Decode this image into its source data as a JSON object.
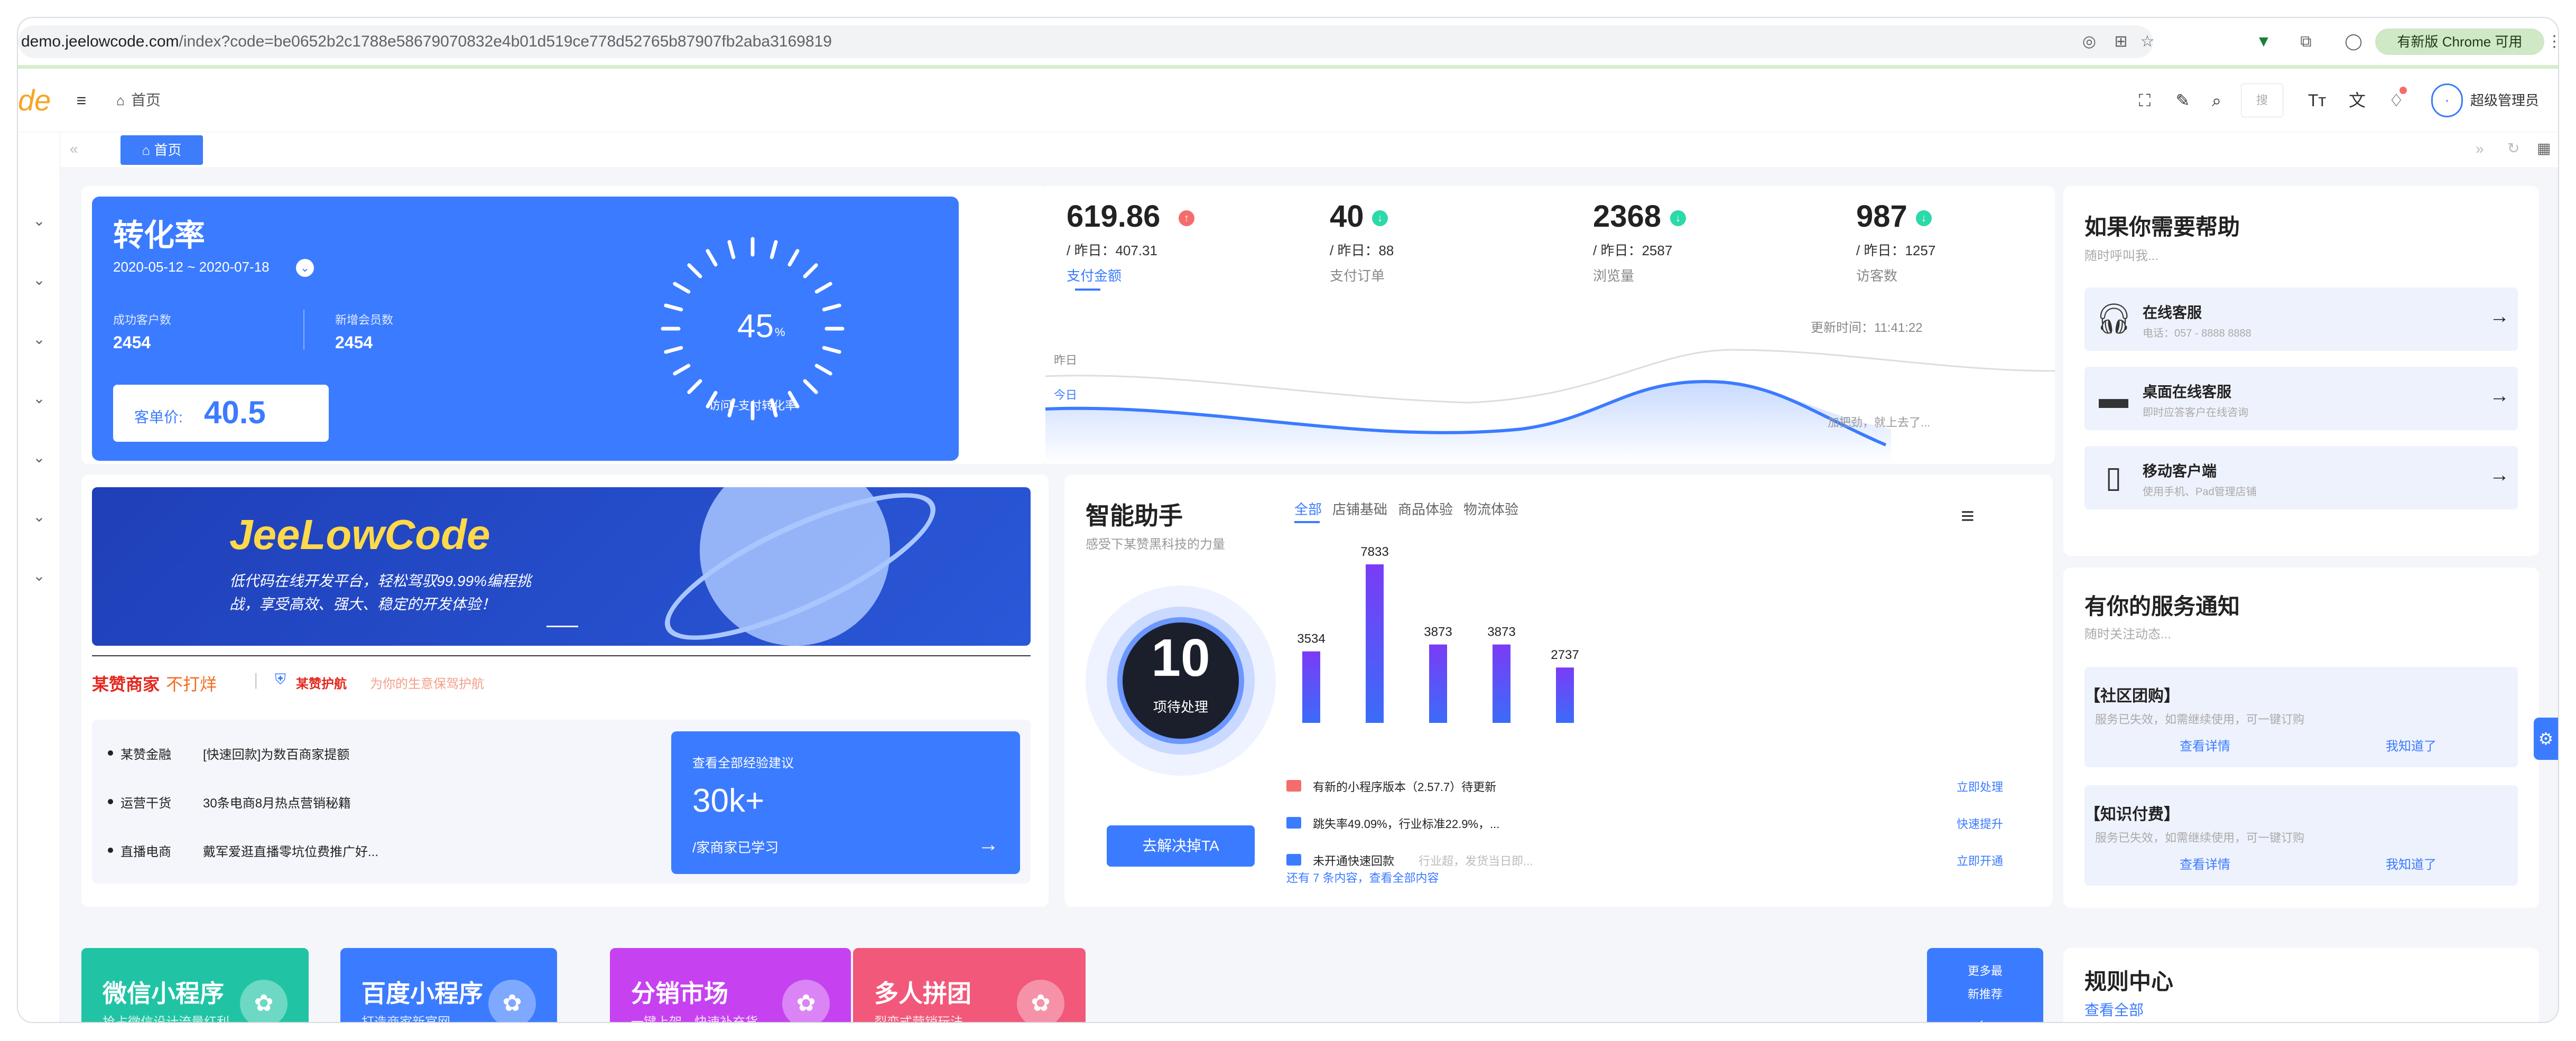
{
  "browser": {
    "url_host": "demo.jeelowcode.com",
    "url_path": "/index?code=be0652b2c1788e58679070832e4b01d519ce778d52765b87907fb2aba3169819",
    "update_button": "有新版 Chrome 可用"
  },
  "header": {
    "breadcrumb": "首页",
    "user": "超级管理员",
    "search_placeholder": "搜"
  },
  "tabs": [
    {
      "label": "首页"
    }
  ],
  "conversion": {
    "title": "转化率",
    "date_range": "2020-05-12 ~ 2020-07-18",
    "stat1_label": "成功客户数",
    "stat1_value": "2454",
    "stat2_label": "新增会员数",
    "stat2_value": "2454",
    "price_label": "客单价:",
    "price_value": "40.5",
    "gauge_value": "45",
    "gauge_unit": "%",
    "gauge_label": "访问–支付转化率"
  },
  "metrics": [
    {
      "value": "619.86",
      "yesterday": "/ 昨日：407.31",
      "label": "支付金额",
      "trend": "up",
      "color": "#f56c6c"
    },
    {
      "value": "40",
      "yesterday": "/ 昨日：88",
      "label": "支付订单",
      "trend": "down",
      "color": "#2bd9a9"
    },
    {
      "value": "2368",
      "yesterday": "/ 昨日：2587",
      "label": "浏览量",
      "trend": "down",
      "color": "#2bd9a9"
    },
    {
      "value": "987",
      "yesterday": "/ 昨日：1257",
      "label": "访客数",
      "trend": "down",
      "color": "#2bd9a9"
    }
  ],
  "trend_chart": {
    "update_time": "更新时间：11:41:22",
    "label_yesterday": "昨日",
    "label_today": "今日",
    "hint": "加把劲，就上去了..."
  },
  "help": {
    "title": "如果你需要帮助",
    "subtitle": "随时呼叫我...",
    "items": [
      {
        "title": "在线客服",
        "desc": "电话：057 - 8888 8888",
        "icon": "headset-icon"
      },
      {
        "title": "桌面在线客服",
        "desc": "即时应答客户在线咨询",
        "icon": "monitor-icon"
      },
      {
        "title": "移动客户端",
        "desc": "使用手机、Pad管理店铺",
        "icon": "mobile-icon"
      }
    ]
  },
  "banner": {
    "brand": "JeeLowCode",
    "line1": "低代码在线开发平台，轻松驾驭99.99%编程挑",
    "line2": "战，享受高效、强大、稳定的开发体验！"
  },
  "merchant": {
    "title_a": "某赞商家",
    "title_b": "不打烊",
    "guard": "某赞护航",
    "guard_desc": "为你的生意保驾护航",
    "list": [
      {
        "tag": "某赞金融",
        "text": "[快速回款]为数百商家提额"
      },
      {
        "tag": "运营干货",
        "text": "30条电商8月热点营销秘籍"
      },
      {
        "tag": "直播电商",
        "text": "戴军爱逛直播零坑位费推广好..."
      }
    ],
    "cta_label": "查看全部经验建议",
    "cta_value": "30k+",
    "cta_desc": "/家商家已学习"
  },
  "assistant": {
    "title": "智能助手",
    "subtitle": "感受下某赞黑科技的力量",
    "tabs": [
      "全部",
      "店铺基础",
      "商品体验",
      "物流体验"
    ],
    "pending_value": "10",
    "pending_label": "项待处理",
    "solve_button": "去解决掉TA",
    "items": [
      {
        "text": "有新的小程序版本（2.57.7）待更新",
        "extra": "",
        "action": "立即处理",
        "color": "#f56c6c"
      },
      {
        "text": "跳失率49.09%，行业标准22.9%，...",
        "extra": "",
        "action": "快速提升",
        "color": "#3b7bff"
      },
      {
        "text": "未开通快速回款",
        "extra": "行业超，发货当日即...",
        "action": "立即开通",
        "color": "#3b7bff"
      }
    ],
    "more": "还有 7 条内容，查看全部内容"
  },
  "chart_data": {
    "type": "bar",
    "categories": [
      "",
      "",
      "",
      "",
      ""
    ],
    "values": [
      3534,
      7833,
      3873,
      3873,
      2737
    ],
    "ylim": [
      0,
      7833
    ]
  },
  "notice": {
    "title": "有你的服务通知",
    "subtitle": "随时关注动态...",
    "items": [
      {
        "title": "【社区团购】",
        "desc": "服务已失效，如需继续使用，可一键订购",
        "detail": "查看详情",
        "known": "我知道了"
      },
      {
        "title": "【知识付费】",
        "desc": "服务已失效，如需继续使用，可一键订购",
        "detail": "查看详情",
        "known": "我知道了"
      }
    ]
  },
  "apps": [
    {
      "title": "微信小程序",
      "desc": "抢占微信设计流量红利",
      "color": "#20c4a4"
    },
    {
      "title": "百度小程序",
      "desc": "打造商家新官网",
      "color": "#3b7bff"
    },
    {
      "title": "分销市场",
      "desc": "一键上架，快速补充货...",
      "color": "#c642f0"
    },
    {
      "title": "多人拼团",
      "desc": "裂变式营销玩法",
      "color": "#f1587a"
    }
  ],
  "more_rec": {
    "line1": "更多最",
    "line2": "新推荐"
  },
  "rules": {
    "title": "规则中心",
    "link": "查看全部"
  }
}
